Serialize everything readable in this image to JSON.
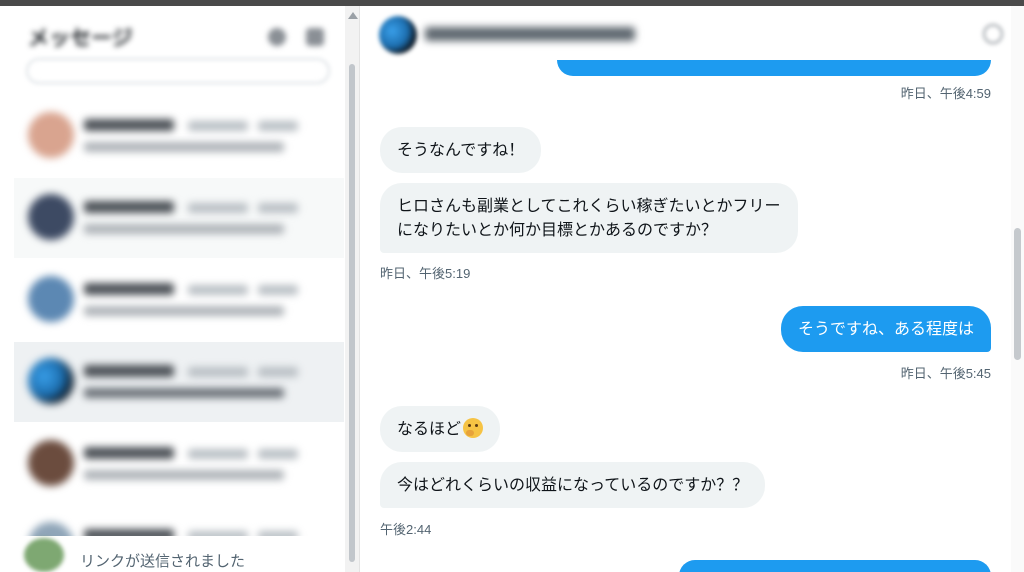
{
  "left_panel": {
    "title": "メッセージ",
    "footer_text": "リンクが送信されました"
  },
  "chat": {
    "messages": [
      {
        "type": "timestamp",
        "side": "right",
        "text": "昨日、午後4:59"
      },
      {
        "type": "bubble",
        "side": "left",
        "text": "そうなんですね！"
      },
      {
        "type": "bubble",
        "side": "left",
        "text": "ヒロさんも副業としてこれくらい稼ぎたいとかフリー",
        "text2": "になりたいとか何か目標とかあるのですか？"
      },
      {
        "type": "timestamp",
        "side": "left",
        "text": "昨日、午後5:19"
      },
      {
        "type": "bubble",
        "side": "right",
        "text": "そうですね、ある程度は"
      },
      {
        "type": "timestamp",
        "side": "right",
        "text": "昨日、午後5:45"
      },
      {
        "type": "bubble",
        "side": "left",
        "text": "なるほど",
        "emoji": "thinking-face"
      },
      {
        "type": "bubble",
        "side": "left",
        "text": "今はどれくらいの収益になっているのですか？？"
      },
      {
        "type": "timestamp",
        "side": "left",
        "text": "午後2:44"
      }
    ]
  },
  "colors": {
    "accent": "#1d9bf0",
    "incoming_bubble": "#eff3f4",
    "timestamp": "#536471",
    "selected_conversation": "#eef1f3"
  }
}
